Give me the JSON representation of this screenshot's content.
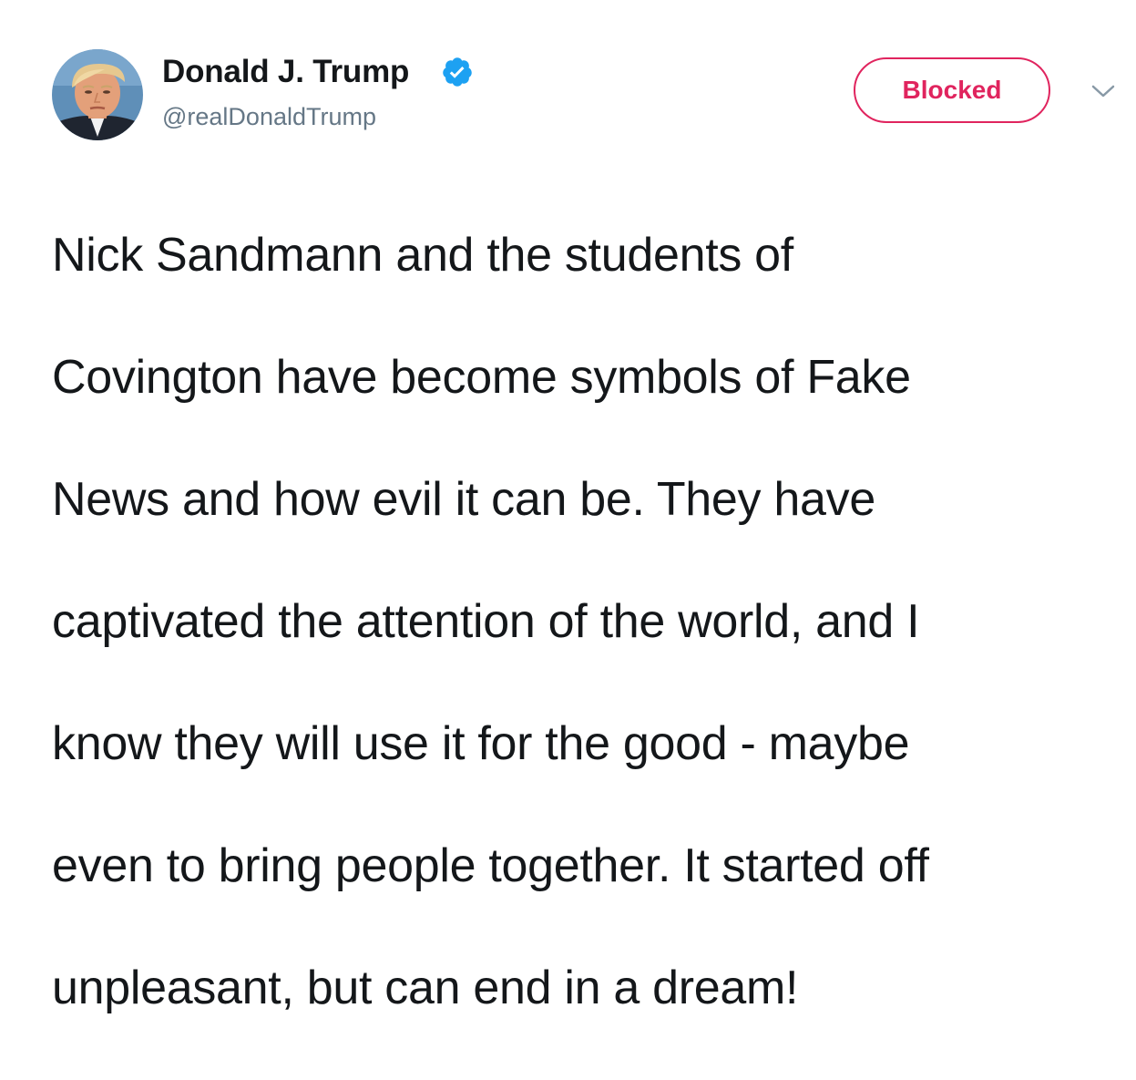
{
  "tweet": {
    "author": {
      "name": "Donald J. Trump",
      "handle": "@realDonaldTrump",
      "verified": true,
      "avatar_icon": "profile-photo"
    },
    "actions": {
      "blocked_label": "Blocked",
      "menu_icon": "chevron-down-icon"
    },
    "text_lines": [
      "Nick Sandmann and the students of",
      "Covington have become symbols of Fake",
      "News and how evil it can be. They have",
      "captivated the attention of the world, and I",
      "know they will use it for the good - maybe",
      "even to bring people together. It started off",
      "unpleasant, but can end in a dream!"
    ]
  },
  "colors": {
    "blocked": "#e0245e",
    "verified": "#1da1f2",
    "handle": "#657786",
    "text": "#14171a"
  }
}
